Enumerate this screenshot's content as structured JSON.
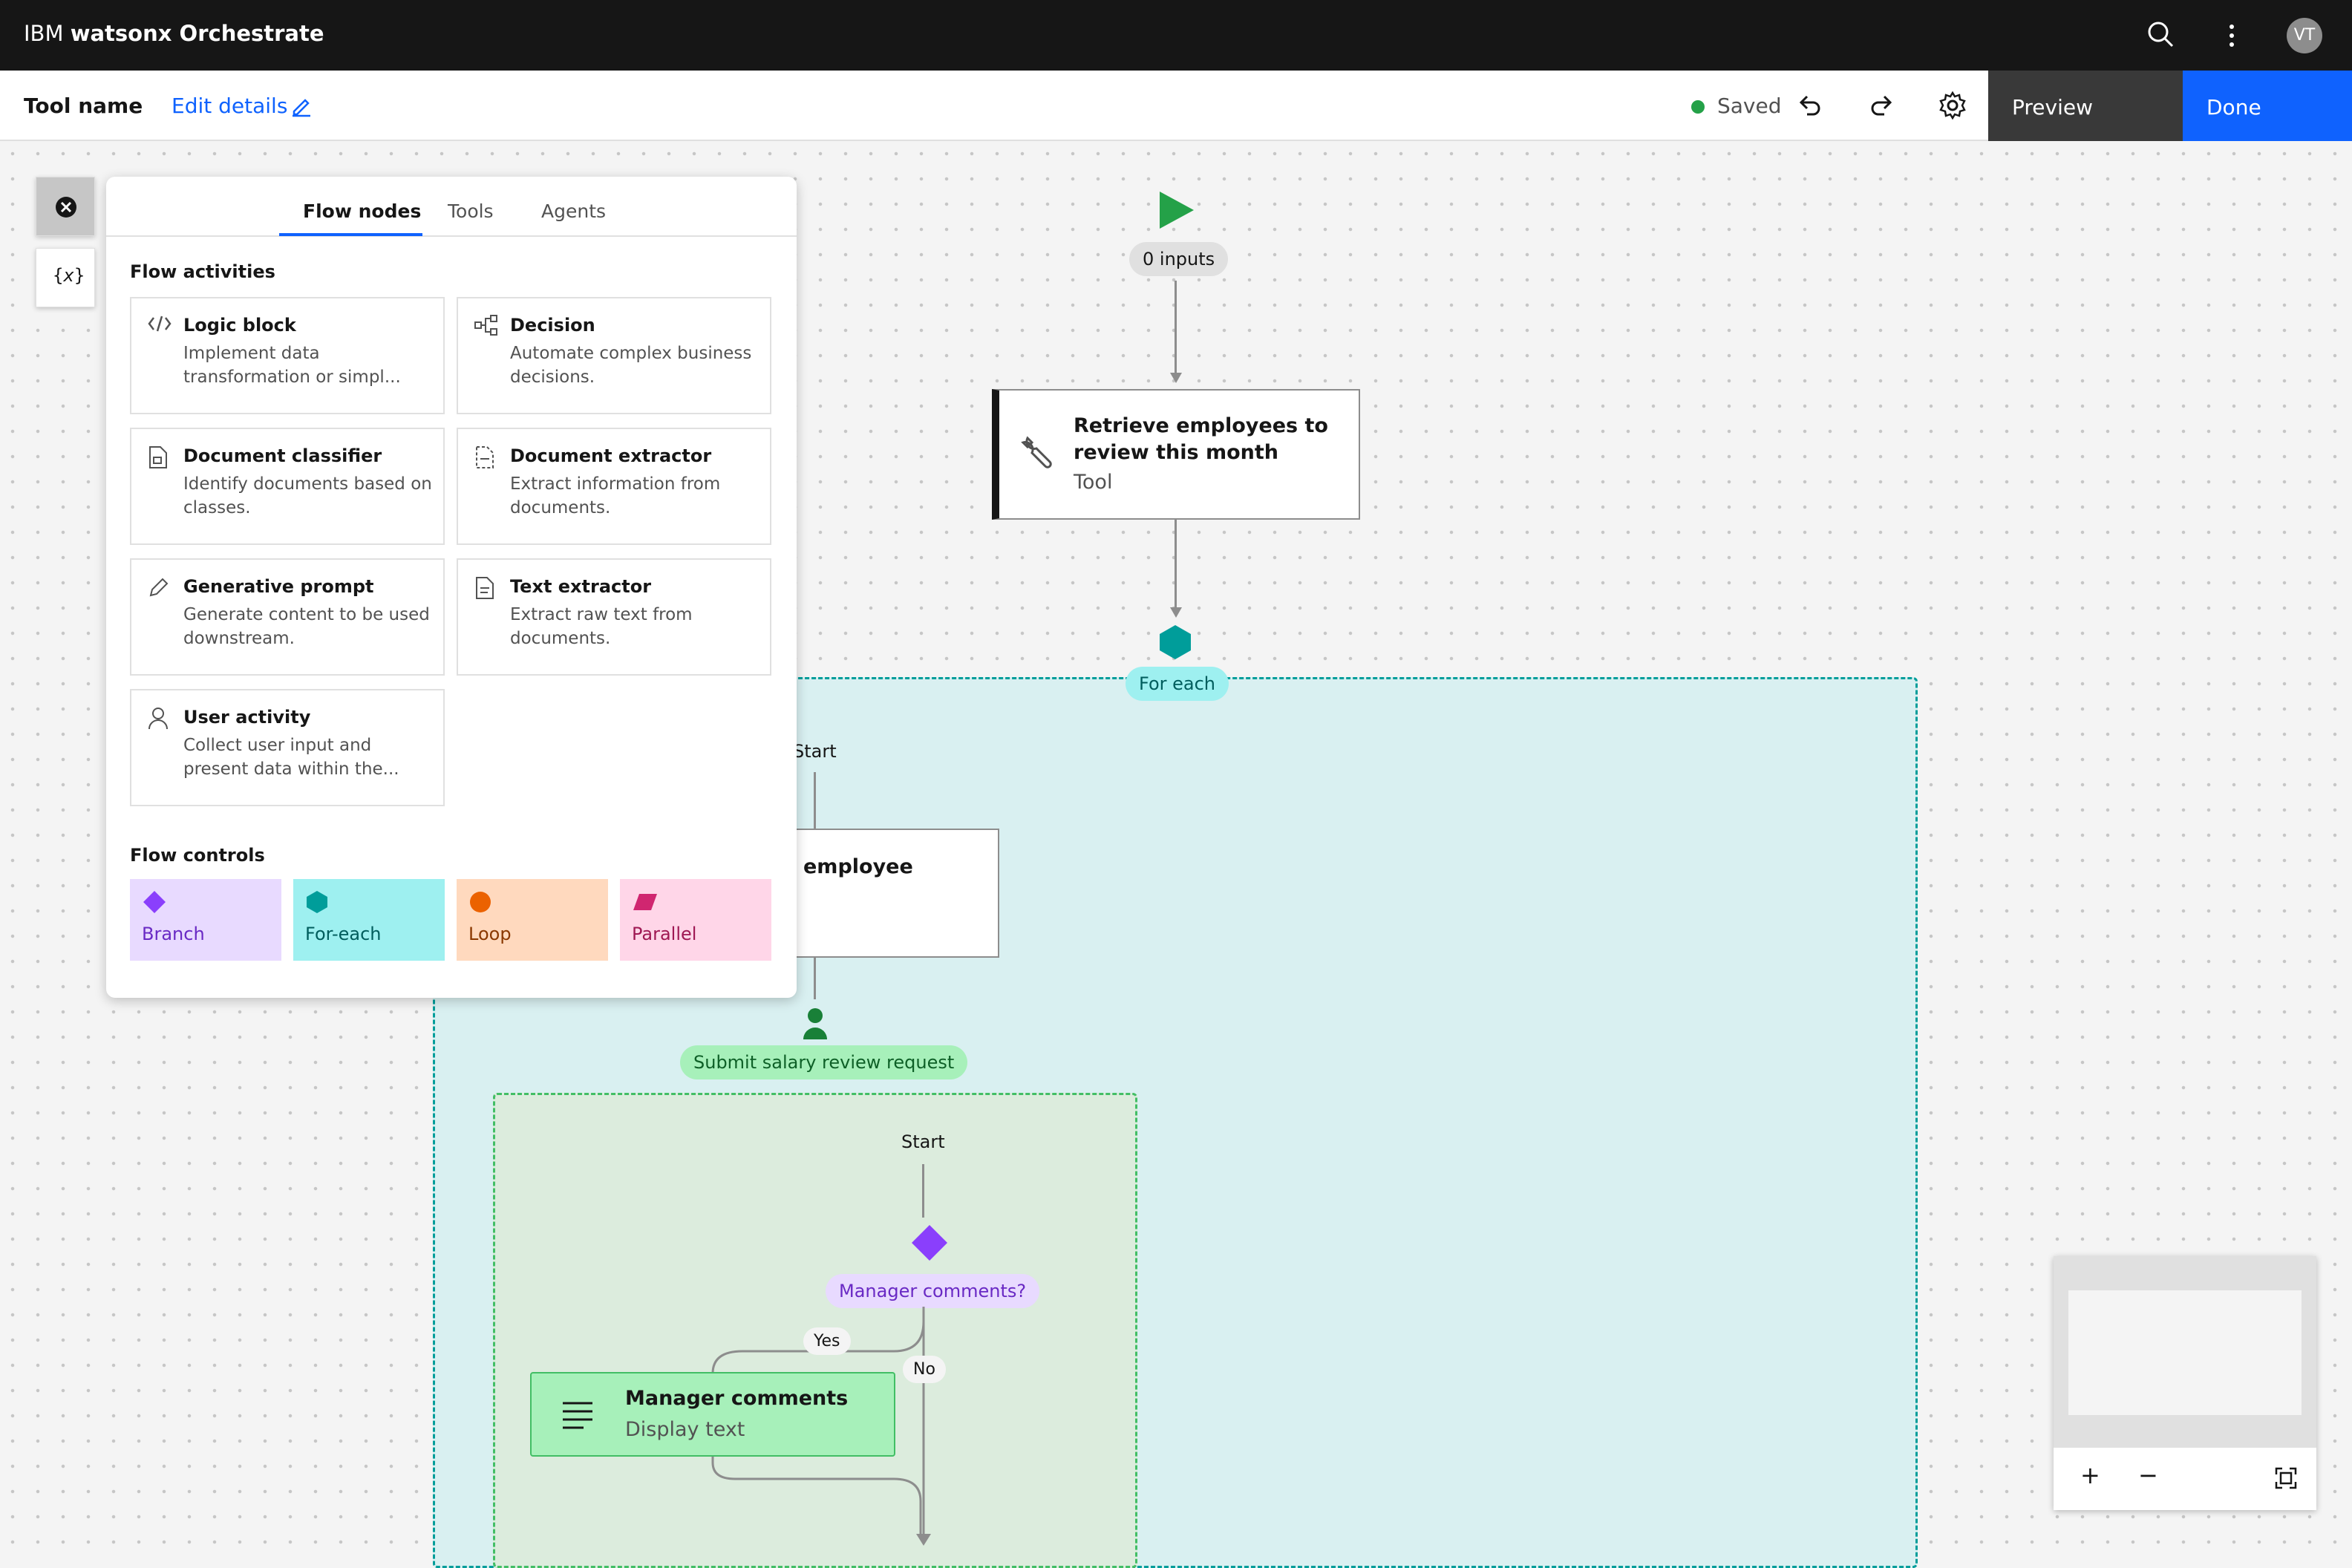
{
  "header": {
    "brand_prefix": "IBM",
    "brand_product": "watsonx Orchestrate",
    "avatar_initials": "VT"
  },
  "toolbar": {
    "tool_name": "Tool name",
    "edit_details": "Edit details",
    "status": "Saved",
    "preview_label": "Preview",
    "done_label": "Done"
  },
  "panel": {
    "tabs": [
      {
        "label": "Flow nodes",
        "active": true
      },
      {
        "label": "Tools",
        "active": false
      },
      {
        "label": "Agents",
        "active": false
      }
    ],
    "activities_title": "Flow activities",
    "activities": [
      {
        "icon": "code-icon",
        "title": "Logic block",
        "desc": "Implement data transformation or simpl..."
      },
      {
        "icon": "decision-tree-icon",
        "title": "Decision",
        "desc": "Automate complex business decisions."
      },
      {
        "icon": "document-classifier-icon",
        "title": "Document classifier",
        "desc": "Identify documents based on classes."
      },
      {
        "icon": "document-extractor-icon",
        "title": "Document extractor",
        "desc": "Extract information from documents."
      },
      {
        "icon": "pen-icon",
        "title": "Generative prompt",
        "desc": "Generate content to be used downstream."
      },
      {
        "icon": "text-extractor-icon",
        "title": "Text extractor",
        "desc": "Extract raw text from documents."
      },
      {
        "icon": "user-icon",
        "title": "User activity",
        "desc": "Collect user input and present data within the..."
      }
    ],
    "controls_title": "Flow controls",
    "controls": [
      {
        "label": "Branch",
        "icon": "diamond-icon",
        "bg": "#e8daff",
        "color": "#6929c4",
        "icon_color": "#8a3ffc"
      },
      {
        "label": "For-each",
        "icon": "hexagon-icon",
        "bg": "#9ef0f0",
        "color": "#005d5d",
        "icon_color": "#009d9a"
      },
      {
        "label": "Loop",
        "icon": "circle-icon",
        "bg": "#ffd9be",
        "color": "#8a3800",
        "icon_color": "#eb6200"
      },
      {
        "label": "Parallel",
        "icon": "parallelogram-icon",
        "bg": "#ffd6e8",
        "color": "#9f1853",
        "icon_color": "#d02670"
      }
    ]
  },
  "canvas": {
    "inputs_label": "0 inputs",
    "tool_node": {
      "title": "Retrieve employees to review this month",
      "subtitle": "Tool"
    },
    "foreach_label": "For each",
    "start_label": "Start",
    "employee_node_title": "employee",
    "user_activity_label": "Submit salary review request",
    "inner_start_label": "Start",
    "branch_label": "Manager comments?",
    "yes_label": "Yes",
    "no_label": "No",
    "display_node": {
      "title": "Manager comments",
      "subtitle": "Display text"
    }
  },
  "minimap": {
    "zoom_in": "+",
    "zoom_out": "−"
  },
  "colors": {
    "accent": "#0f62fe",
    "start_play": "#24a148",
    "foreach": "#009d9a",
    "user_activity": "#198038",
    "branch": "#8a3ffc"
  }
}
